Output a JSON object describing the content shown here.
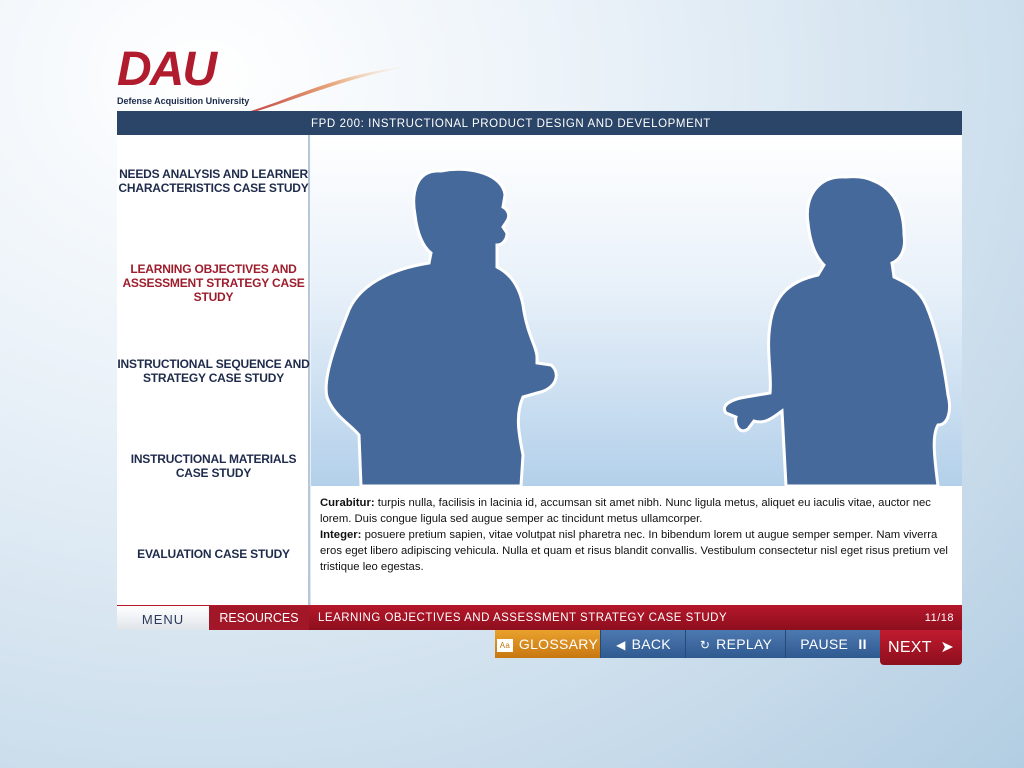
{
  "logo": {
    "brand": "DAU",
    "subtitle": "Defense Acquisition University"
  },
  "course_title": "FPD 200: INSTRUCTIONAL PRODUCT DESIGN AND DEVELOPMENT",
  "sidebar": {
    "items": [
      {
        "label": "NEEDS ANALYSIS AND LEARNER CHARACTERISTICS CASE STUDY",
        "active": false
      },
      {
        "label": "LEARNING OBJECTIVES AND ASSESSMENT STRATEGY CASE STUDY",
        "active": true
      },
      {
        "label": "INSTRUCTIONAL SEQUENCE AND STRATEGY CASE STUDY",
        "active": false
      },
      {
        "label": "INSTRUCTIONAL MATERIALS CASE STUDY",
        "active": false
      },
      {
        "label": "EVALUATION CASE STUDY",
        "active": false
      }
    ]
  },
  "content": {
    "paragraph1_lead": "Curabitur:",
    "paragraph1_body": " turpis nulla, facilisis in lacinia id, accumsan sit amet nibh. Nunc ligula metus, aliquet eu iaculis vitae, auctor nec lorem. Duis congue ligula sed augue semper ac tincidunt metus ullamcorper.",
    "paragraph2_lead": "Integer:",
    "paragraph2_body": " posuere pretium sapien, vitae volutpat nisl pharetra nec. In bibendum lorem ut augue semper semper. Nam viverra eros eget libero adipiscing vehicula. Nulla et quam et risus blandit convallis. Vestibulum consectetur nisl eget risus pretium vel tristique leo egestas."
  },
  "footer": {
    "menu_label": "MENU",
    "resources_label": "RESOURCES",
    "breadcrumb": "LEARNING OBJECTIVES AND ASSESSMENT STRATEGY CASE STUDY",
    "page_indicator": "11/18"
  },
  "nav": {
    "glossary": "GLOSSARY",
    "back": "BACK",
    "replay": "REPLAY",
    "pause": "PAUSE",
    "pause_glyph": "II",
    "next": "NEXT"
  },
  "colors": {
    "navy": "#2b4568",
    "brand_red": "#b01b2e",
    "active_link": "#9e1d2c",
    "glossary_orange": "#e0921f",
    "nav_blue": "#3d6aa3",
    "silhouette": "#46699b"
  },
  "icons": [
    "glossary-icon",
    "back-arrow-icon",
    "replay-icon",
    "pause-icon",
    "next-arrow-icon"
  ]
}
